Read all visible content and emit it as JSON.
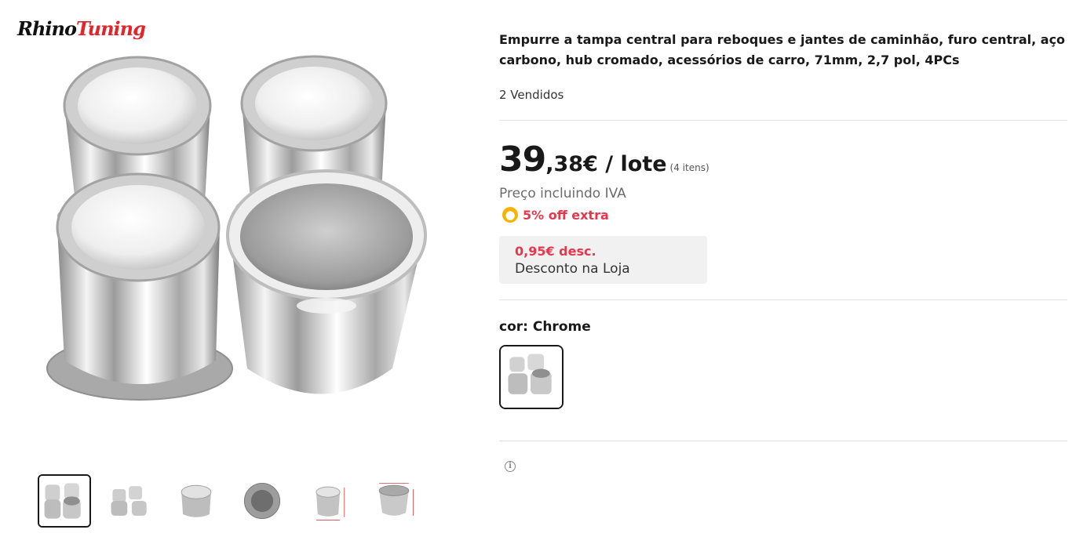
{
  "brand": {
    "logo_part1": "Rhino",
    "logo_part2": "Tuning"
  },
  "product": {
    "title": "Empurre a tampa central para reboques e jantes de caminhão, furo central, aço carbono, hub cromado, acessórios de carro, 71mm, 2,7 pol, 4PCs",
    "sold": "2 Vendidos"
  },
  "price": {
    "integer": "39",
    "decimal": ",38€",
    "unit": " / lote",
    "quantity": "(4 itens)",
    "vat_note": "Preço incluindo IVA",
    "extra_discount": "5% off extra"
  },
  "coupon": {
    "amount": "0,95€ desc.",
    "label": "Desconto na Loja"
  },
  "variant": {
    "label": "cor: Chrome"
  },
  "thumbnails": [
    {
      "name": "thumb-four-caps",
      "active": true
    },
    {
      "name": "thumb-caps-angle",
      "active": false
    },
    {
      "name": "thumb-single-cap",
      "active": false
    },
    {
      "name": "thumb-cap-top",
      "active": false
    },
    {
      "name": "thumb-cap-dimensions",
      "active": false
    },
    {
      "name": "thumb-cap-open-dimensions",
      "active": false
    }
  ],
  "colors": {
    "accent_red": "#e9364b",
    "coin_yellow": "#f6b400",
    "text": "#191919"
  },
  "icons": {
    "coin": "coin-icon",
    "info": "info-icon"
  }
}
